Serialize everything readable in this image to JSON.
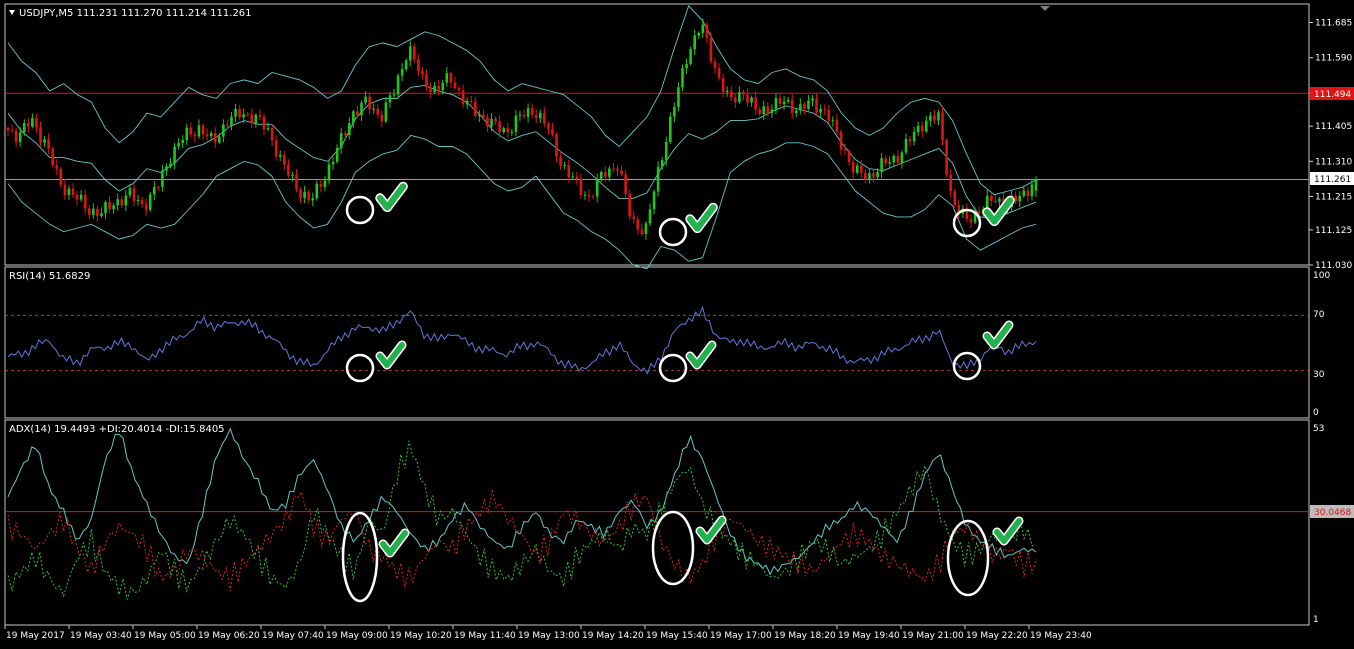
{
  "colors": {
    "background": "#000000",
    "frame": "#c8c8c8",
    "text": "#ffffff",
    "bull": "#1ec81e",
    "bear": "#e01414",
    "bands": "#64c8c8",
    "level_line": "#e01414",
    "price_line": "#9a9a9a",
    "rsi": "#5b7bdc",
    "rsi_levels": "#c83232",
    "adx": "#64c8c8",
    "plus_di": "#2ec82e",
    "minus_di": "#e02222",
    "marker_circle": "#ffffff",
    "check": "#22b14c",
    "tag_red_bg": "#e01414",
    "tag_gray_bg": "#bdbdbd"
  },
  "main_panel": {
    "header": "USDJPY,M5  111.231 111.270 111.214 111.261",
    "price_ticks": [
      "111.685",
      "111.590",
      "111.495",
      "111.405",
      "111.310",
      "111.215",
      "111.125",
      "111.030"
    ],
    "level_tag": "111.494",
    "current_price_tag": "111.261"
  },
  "rsi_panel": {
    "header": "RSI(14) 51.6829",
    "ticks": [
      "100",
      "70",
      "30",
      "0"
    ]
  },
  "adx_panel": {
    "header": "ADX(14) 19.4493 +DI:20.4014 -DI:15.8405",
    "top_tick": "53",
    "bottom_tick": "1",
    "level_tag": "30.0468"
  },
  "time_axis": [
    "19 May 2017",
    "19 May 03:40",
    "19 May 05:00",
    "19 May 06:20",
    "19 May 07:40",
    "19 May 09:00",
    "19 May 10:20",
    "19 May 11:40",
    "19 May 13:00",
    "19 May 14:20",
    "19 May 15:40",
    "19 May 17:00",
    "19 May 18:20",
    "19 May 19:40",
    "19 May 21:00",
    "19 May 22:20",
    "19 May 23:40"
  ],
  "chart_data": [
    {
      "type": "candlestick",
      "title": "USDJPY,M5",
      "ohlc_last": {
        "open": 111.231,
        "high": 111.27,
        "low": 111.214,
        "close": 111.261
      },
      "ylim": [
        111.03,
        111.735
      ],
      "ticks": [
        111.685,
        111.59,
        111.495,
        111.405,
        111.31,
        111.215,
        111.125,
        111.03
      ],
      "horizontal_levels": [
        111.494,
        111.261
      ],
      "x": [
        "19 May 2017",
        "19 May 03:40",
        "19 May 05:00",
        "19 May 06:20",
        "19 May 07:40",
        "19 May 09:00",
        "19 May 10:20",
        "19 May 11:40",
        "19 May 13:00",
        "19 May 14:20",
        "19 May 15:40",
        "19 May 17:00",
        "19 May 18:20",
        "19 May 19:40",
        "19 May 21:00",
        "19 May 22:20",
        "19 May 23:40"
      ],
      "close_path": [
        111.4,
        111.38,
        111.42,
        111.36,
        111.25,
        111.22,
        111.18,
        111.17,
        111.2,
        111.22,
        111.19,
        111.24,
        111.33,
        111.38,
        111.4,
        111.36,
        111.42,
        111.44,
        111.43,
        111.39,
        111.3,
        111.24,
        111.2,
        111.27,
        111.35,
        111.44,
        111.47,
        111.43,
        111.5,
        111.62,
        111.53,
        111.5,
        111.54,
        111.47,
        111.44,
        111.41,
        111.39,
        111.43,
        111.45,
        111.4,
        111.3,
        111.25,
        111.21,
        111.28,
        111.3,
        111.15,
        111.12,
        111.3,
        111.45,
        111.6,
        111.68,
        111.56,
        111.47,
        111.5,
        111.44,
        111.46,
        111.47,
        111.45,
        111.47,
        111.44,
        111.36,
        111.28,
        111.27,
        111.3,
        111.32,
        111.37,
        111.42,
        111.43,
        111.2,
        111.15,
        111.18,
        111.21,
        111.19,
        111.22,
        111.26
      ],
      "bollinger_bands": {
        "upper": [
          111.63,
          111.58,
          111.55,
          111.5,
          111.52,
          111.49,
          111.47,
          111.4,
          111.36,
          111.39,
          111.44,
          111.43,
          111.47,
          111.51,
          111.49,
          111.48,
          111.52,
          111.53,
          111.52,
          111.55,
          111.54,
          111.53,
          111.51,
          111.48,
          111.5,
          111.57,
          111.62,
          111.63,
          111.62,
          111.64,
          111.66,
          111.65,
          111.63,
          111.61,
          111.58,
          111.53,
          111.5,
          111.52,
          111.51,
          111.5,
          111.49,
          111.46,
          111.43,
          111.38,
          111.35,
          111.39,
          111.43,
          111.5,
          111.62,
          111.73,
          111.69,
          111.62,
          111.56,
          111.53,
          111.52,
          111.55,
          111.56,
          111.54,
          111.53,
          111.5,
          111.44,
          111.4,
          111.38,
          111.4,
          111.44,
          111.47,
          111.48,
          111.47,
          111.42,
          111.33,
          111.25,
          111.22,
          111.23,
          111.24,
          111.26
        ],
        "lower": [
          111.25,
          111.2,
          111.17,
          111.14,
          111.12,
          111.13,
          111.14,
          111.12,
          111.1,
          111.11,
          111.14,
          111.13,
          111.14,
          111.18,
          111.22,
          111.27,
          111.29,
          111.31,
          111.3,
          111.27,
          111.2,
          111.16,
          111.13,
          111.14,
          111.2,
          111.28,
          111.31,
          111.33,
          111.34,
          111.38,
          111.37,
          111.35,
          111.35,
          111.33,
          111.29,
          111.25,
          111.23,
          111.24,
          111.27,
          111.22,
          111.17,
          111.15,
          111.12,
          111.1,
          111.07,
          111.03,
          111.02,
          111.08,
          111.07,
          111.04,
          111.05,
          111.16,
          111.28,
          111.31,
          111.33,
          111.34,
          111.36,
          111.36,
          111.35,
          111.33,
          111.28,
          111.23,
          111.2,
          111.17,
          111.16,
          111.16,
          111.18,
          111.22,
          111.19,
          111.1,
          111.07,
          111.09,
          111.11,
          111.13,
          111.14
        ]
      },
      "annotations": [
        "white circle and green check mark at 111.15 near 19 May 09:00",
        "white circle and green check mark at 111.11 near 19 May 15:40",
        "white circle and green check mark at 111.13 near 19 May 22:20"
      ]
    },
    {
      "type": "line",
      "title": "RSI(14) 51.6829",
      "ylim": [
        0,
        100
      ],
      "ticks": [
        100,
        70,
        30,
        0
      ],
      "levels": [
        70,
        30
      ],
      "x": [
        "19 May 2017",
        "19 May 03:40",
        "19 May 05:00",
        "19 May 06:20",
        "19 May 07:40",
        "19 May 09:00",
        "19 May 10:20",
        "19 May 11:40",
        "19 May 13:00",
        "19 May 14:20",
        "19 May 15:40",
        "19 May 17:00",
        "19 May 18:20",
        "19 May 19:40",
        "19 May 21:00",
        "19 May 22:20",
        "19 May 23:40"
      ],
      "series": [
        {
          "name": "RSI(14)",
          "values": [
            40,
            42,
            48,
            52,
            38,
            36,
            45,
            47,
            50,
            48,
            36,
            46,
            52,
            58,
            66,
            62,
            64,
            66,
            60,
            54,
            44,
            36,
            34,
            44,
            55,
            60,
            62,
            58,
            66,
            72,
            56,
            52,
            58,
            50,
            46,
            44,
            42,
            48,
            50,
            44,
            34,
            32,
            34,
            44,
            48,
            36,
            28,
            40,
            58,
            68,
            72,
            56,
            50,
            52,
            46,
            48,
            50,
            47,
            50,
            46,
            40,
            36,
            38,
            42,
            46,
            50,
            54,
            58,
            36,
            32,
            40,
            48,
            44,
            48,
            52
          ]
        }
      ],
      "annotations": [
        "white circle and green check mark near 19 May 09:00",
        "white circle and green check mark near 19 May 15:40",
        "white circle and green check mark near 19 May 22:20"
      ]
    },
    {
      "type": "line",
      "title": "ADX(14) 19.4493 +DI:20.4014 -DI:15.8405",
      "ylim": [
        1,
        53
      ],
      "ticks": [
        53,
        1
      ],
      "levels": [
        30.0468
      ],
      "x": [
        "19 May 2017",
        "19 May 03:40",
        "19 May 05:00",
        "19 May 06:20",
        "19 May 07:40",
        "19 May 09:00",
        "19 May 10:20",
        "19 May 11:40",
        "19 May 13:00",
        "19 May 14:20",
        "19 May 15:40",
        "19 May 17:00",
        "19 May 18:20",
        "19 May 19:40",
        "19 May 21:00",
        "19 May 22:20",
        "19 May 23:40"
      ],
      "series": [
        {
          "name": "ADX(14)",
          "values": [
            34,
            42,
            48,
            36,
            30,
            22,
            28,
            44,
            52,
            40,
            32,
            24,
            18,
            16,
            30,
            45,
            52,
            44,
            38,
            30,
            32,
            40,
            44,
            36,
            26,
            22,
            28,
            34,
            30,
            24,
            20,
            22,
            28,
            32,
            26,
            22,
            20,
            26,
            30,
            24,
            22,
            28,
            26,
            24,
            30,
            33,
            26,
            30,
            40,
            50,
            44,
            34,
            24,
            18,
            16,
            14,
            16,
            18,
            22,
            26,
            28,
            32,
            30,
            26,
            22,
            30,
            40,
            46,
            36,
            26,
            22,
            20,
            18,
            20,
            19.4
          ]
        },
        {
          "name": "+DI",
          "values": [
            10,
            14,
            18,
            12,
            8,
            18,
            22,
            14,
            10,
            8,
            12,
            20,
            14,
            10,
            16,
            22,
            28,
            24,
            18,
            12,
            10,
            16,
            30,
            24,
            18,
            14,
            28,
            24,
            40,
            48,
            36,
            28,
            30,
            24,
            18,
            14,
            12,
            16,
            20,
            14,
            12,
            18,
            22,
            24,
            20,
            26,
            24,
            30,
            38,
            42,
            32,
            26,
            22,
            18,
            16,
            12,
            14,
            18,
            22,
            20,
            16,
            18,
            20,
            24,
            30,
            36,
            42,
            30,
            22,
            18,
            20,
            24,
            22,
            26,
            20.4
          ]
        },
        {
          "name": "-DI",
          "values": [
            26,
            24,
            20,
            24,
            28,
            20,
            14,
            22,
            26,
            24,
            20,
            12,
            14,
            20,
            18,
            14,
            12,
            16,
            20,
            24,
            28,
            36,
            26,
            22,
            28,
            30,
            20,
            18,
            14,
            12,
            18,
            22,
            20,
            26,
            30,
            34,
            28,
            24,
            18,
            22,
            30,
            28,
            24,
            22,
            26,
            32,
            34,
            22,
            16,
            12,
            16,
            24,
            28,
            26,
            22,
            20,
            18,
            16,
            14,
            18,
            22,
            24,
            22,
            18,
            16,
            14,
            12,
            16,
            24,
            26,
            22,
            18,
            20,
            16,
            15.8
          ]
        }
      ],
      "annotations": [
        "white ellipse and green check mark near 19 May 09:00",
        "white ellipse and green check mark near 19 May 15:40",
        "white ellipse and green check mark near 19 May 22:20"
      ]
    }
  ]
}
